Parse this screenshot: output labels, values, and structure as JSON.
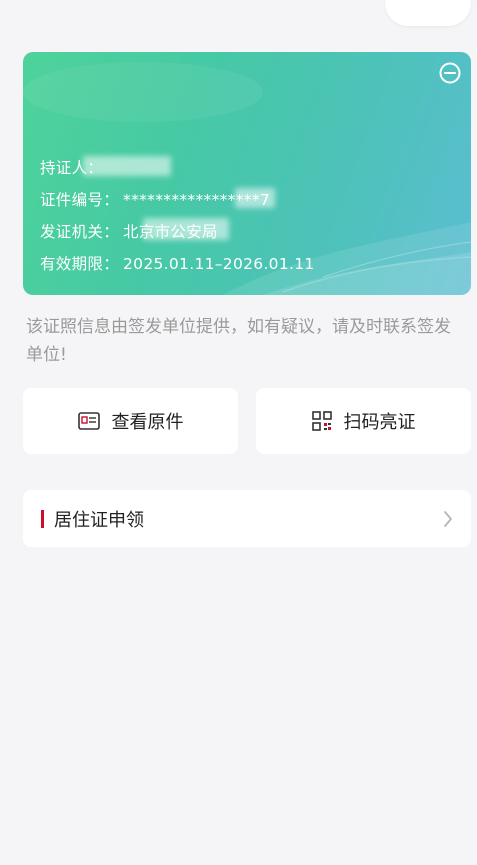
{
  "card": {
    "holder_label": "持证人：",
    "id_label": "证件编号：",
    "id_value": "*****************7",
    "issuer_label": "发证机关：",
    "issuer_value": "北京市公安局",
    "valid_label": "有效期限：",
    "valid_value": "2025.01.11–2026.01.11"
  },
  "notice": "该证照信息由签发单位提供，如有疑议，请及时联系签发单位!",
  "actions": {
    "view_original": "查看原件",
    "scan_show": "扫码亮证"
  },
  "apply": {
    "label": "居住证申领"
  },
  "colors": {
    "card_start": "#4fd39a",
    "card_end": "#5bbdd2",
    "accent_bar": "#c8102e",
    "notice_text": "#9a9a9a",
    "background": "#f5f5f7"
  },
  "icons": {
    "collapse": "minus-circle-icon",
    "view_original": "id-card-icon",
    "scan_show": "qr-code-icon",
    "apply_arrow": "chevron-right-icon"
  }
}
